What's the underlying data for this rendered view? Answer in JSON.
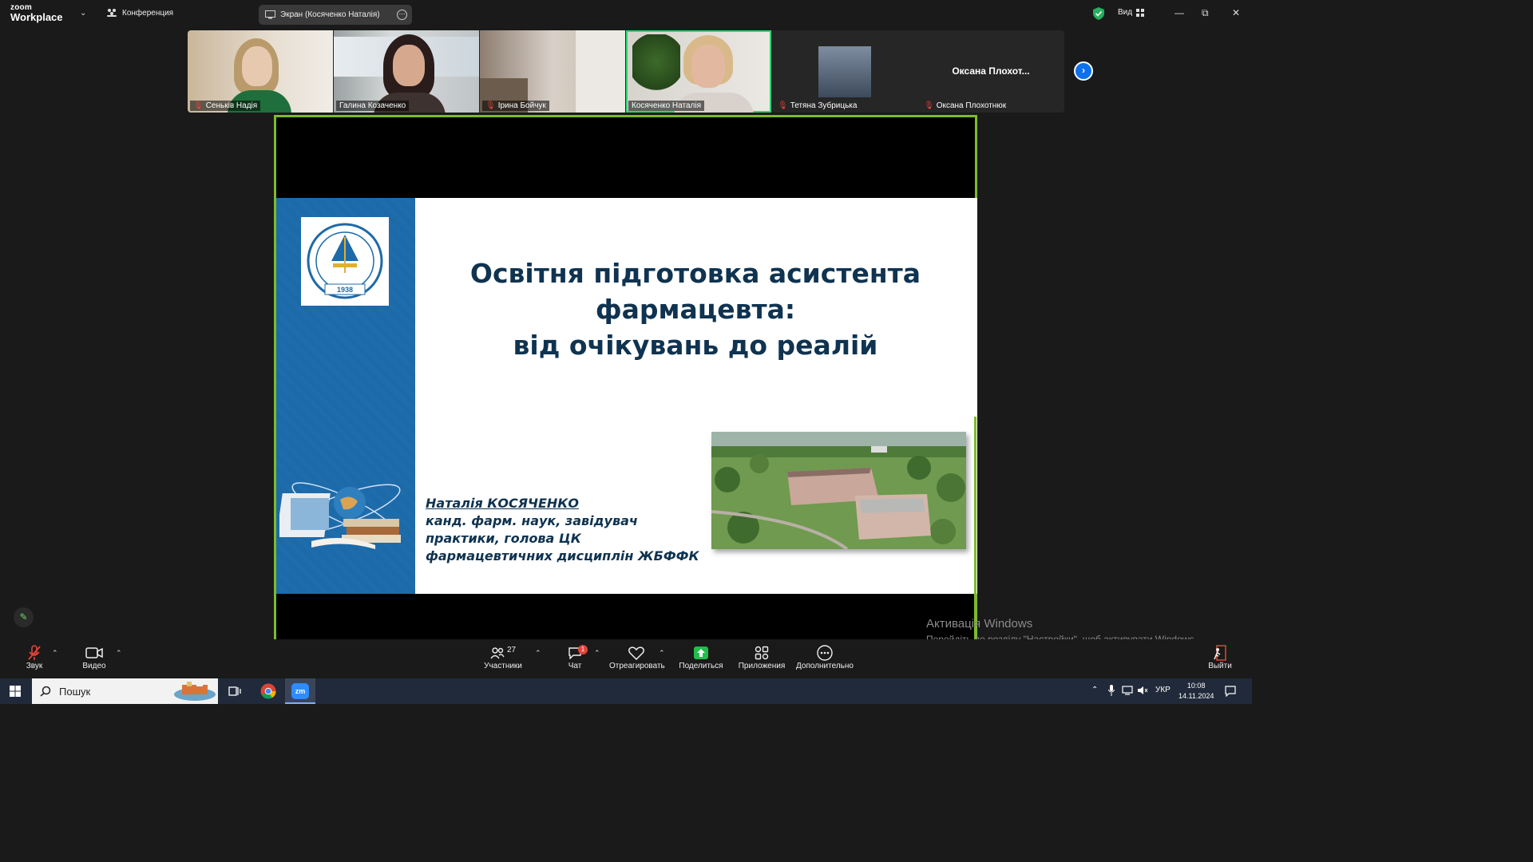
{
  "app": {
    "brand_top": "zoom",
    "brand_bottom": "Workplace"
  },
  "topbar": {
    "conference_label": "Конференция",
    "screen_tab_label": "Экран (Косяченко Наталія)",
    "view_label": "Вид"
  },
  "participants": [
    {
      "name": "Сеньків Надія",
      "muted": true
    },
    {
      "name": "Галина Козаченко",
      "muted": false
    },
    {
      "name": "Ірина Бойчук",
      "muted": true
    },
    {
      "name": "Косяченко Наталія",
      "muted": false,
      "active_speaker": true
    },
    {
      "name": "Тетяна Зубрицька",
      "muted": true
    },
    {
      "name": "Оксана Плохотнюк",
      "muted": true,
      "avatar_text": "Оксана  Плохот..."
    }
  ],
  "slide": {
    "title_line1": "Освітня підготовка асистента",
    "title_line2": "фармацевта:",
    "title_line3": "від очікувань до реалій",
    "author_name": "Наталія КОСЯЧЕНКО",
    "author_line1": "канд. фарм. наук, завідувач",
    "author_line2": "практики, голова ЦК",
    "author_line3": "фармацевтичних дисциплін ЖБФФК",
    "emblem_year": "1938"
  },
  "watermark": {
    "line1": "Активація Windows",
    "line2": "Перейдіть до розділу \"Настройки\", щоб активувати Windows."
  },
  "toolbar": {
    "audio": "Звук",
    "video": "Видео",
    "participants": "Участники",
    "participants_count": "27",
    "chat": "Чат",
    "chat_badge": "1",
    "react": "Отреагировать",
    "share": "Поделиться",
    "apps": "Приложения",
    "more": "Дополнительно",
    "leave": "Выйти"
  },
  "taskbar": {
    "search_placeholder": "Пошук",
    "lang": "УКР",
    "time": "10:08",
    "date": "14.11.2024",
    "zoom_app": "zm"
  },
  "colors": {
    "zoom_blue": "#0e71eb",
    "share_border": "#7dbb2c",
    "active_speaker": "#2ed573",
    "slide_title": "#0f3350",
    "slide_sidebar": "#1d6aa8",
    "share_green": "#1fbf4a"
  }
}
